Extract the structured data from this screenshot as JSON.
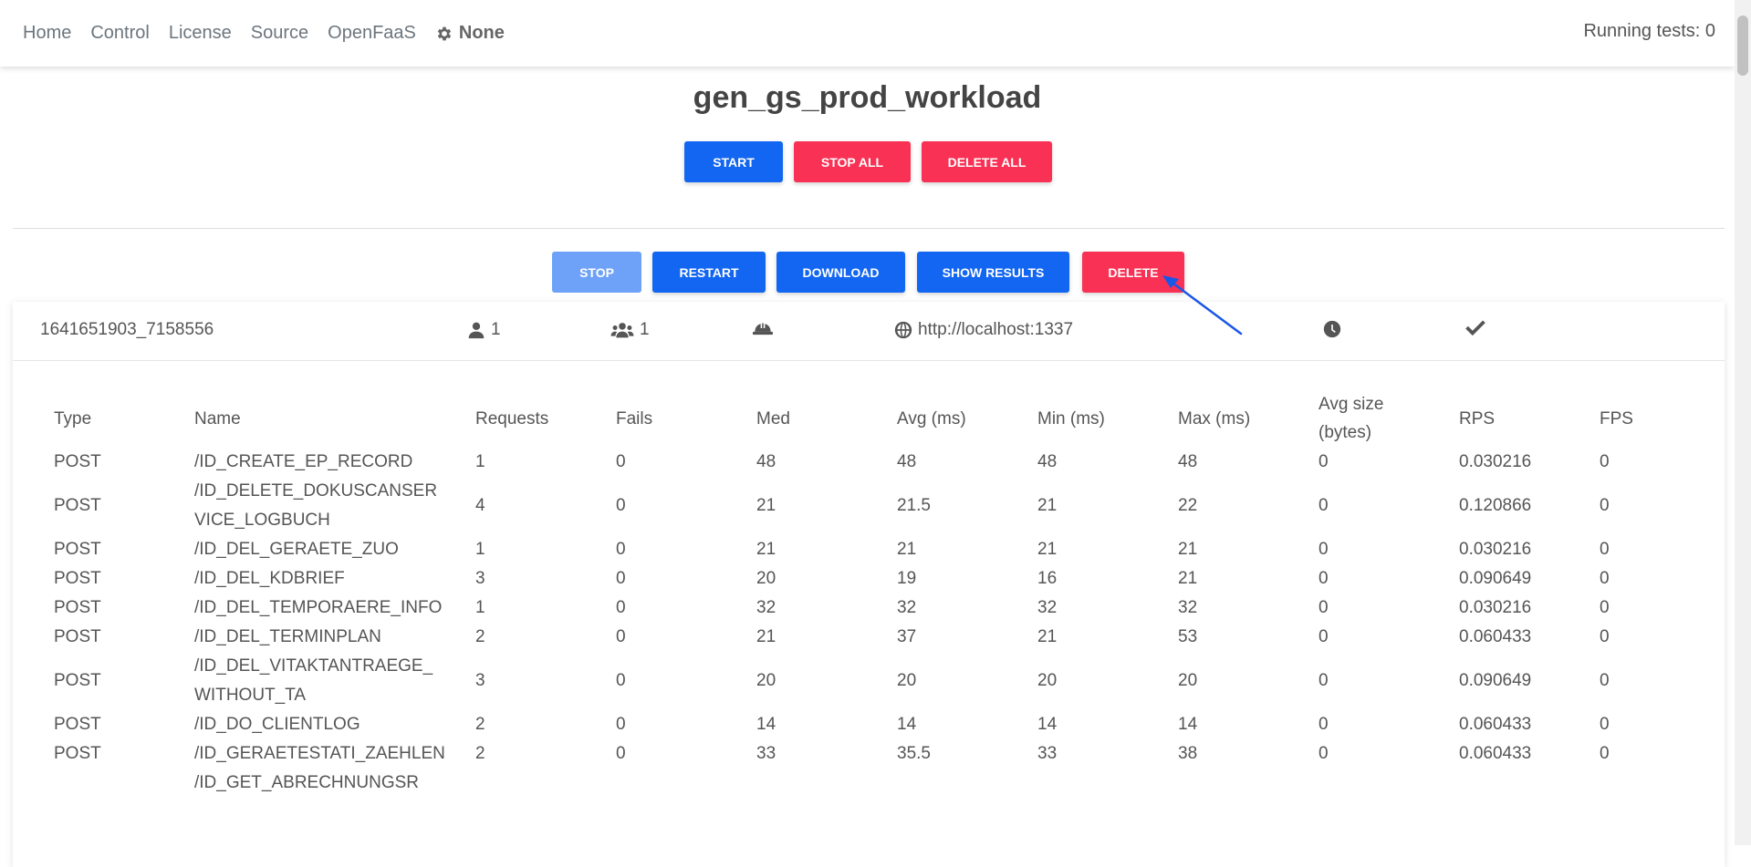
{
  "nav": {
    "items": [
      "Home",
      "Control",
      "License",
      "Source",
      "OpenFaaS"
    ],
    "config_label": "None",
    "running_tests": "Running tests: 0"
  },
  "title": "gen_gs_prod_workload",
  "top_buttons": {
    "start": "START",
    "stop_all": "STOP ALL",
    "delete_all": "DELETE ALL"
  },
  "test_buttons": {
    "stop": "STOP",
    "restart": "RESTART",
    "download": "DOWNLOAD",
    "show_results": "SHOW RESULTS",
    "delete": "DELETE"
  },
  "test_info": {
    "id": "1641651903_7158556",
    "users": "1",
    "spawn_rate": "1",
    "host": "http://localhost:1337"
  },
  "icons": {
    "config": "gear-icon",
    "users": "user-icon",
    "spawn_rate": "users-icon",
    "workers": "hard-hat-icon",
    "host": "globe-icon",
    "duration": "clock-icon",
    "status": "check-icon",
    "annotation": "arrow-icon"
  },
  "colors": {
    "primary": "#1266f1",
    "danger": "#f93154",
    "disabled": "#6ea2f8",
    "annotation": "#1a56e8"
  },
  "table": {
    "headers": [
      "Type",
      "Name",
      "Requests",
      "Fails",
      "Med",
      "Avg (ms)",
      "Min (ms)",
      "Max (ms)",
      "Avg size (bytes)",
      "RPS",
      "FPS"
    ],
    "rows": [
      [
        "POST",
        "/ID_CREATE_EP_RECORD",
        "1",
        "0",
        "48",
        "48",
        "48",
        "48",
        "0",
        "0.030216",
        "0"
      ],
      [
        "POST",
        "/ID_DELETE_DOKUSCANSERVICE_LOGBUCH",
        "4",
        "0",
        "21",
        "21.5",
        "21",
        "22",
        "0",
        "0.120866",
        "0"
      ],
      [
        "POST",
        "/ID_DEL_GERAETE_ZUO",
        "1",
        "0",
        "21",
        "21",
        "21",
        "21",
        "0",
        "0.030216",
        "0"
      ],
      [
        "POST",
        "/ID_DEL_KDBRIEF",
        "3",
        "0",
        "20",
        "19",
        "16",
        "21",
        "0",
        "0.090649",
        "0"
      ],
      [
        "POST",
        "/ID_DEL_TEMPORAERE_INFO",
        "1",
        "0",
        "32",
        "32",
        "32",
        "32",
        "0",
        "0.030216",
        "0"
      ],
      [
        "POST",
        "/ID_DEL_TERMINPLAN",
        "2",
        "0",
        "21",
        "37",
        "21",
        "53",
        "0",
        "0.060433",
        "0"
      ],
      [
        "POST",
        "/ID_DEL_VITAKTANTRAEGE_WITHOUT_TA",
        "3",
        "0",
        "20",
        "20",
        "20",
        "20",
        "0",
        "0.090649",
        "0"
      ],
      [
        "POST",
        "/ID_DO_CLIENTLOG",
        "2",
        "0",
        "14",
        "14",
        "14",
        "14",
        "0",
        "0.060433",
        "0"
      ],
      [
        "POST",
        "/ID_GERAETESTATI_ZAEHLEN",
        "2",
        "0",
        "33",
        "35.5",
        "33",
        "38",
        "0",
        "0.060433",
        "0"
      ],
      [
        "",
        "/ID_GET_ABRECHNUNGSR",
        "",
        "",
        "",
        "",
        "",
        "",
        "",
        "",
        ""
      ]
    ]
  }
}
